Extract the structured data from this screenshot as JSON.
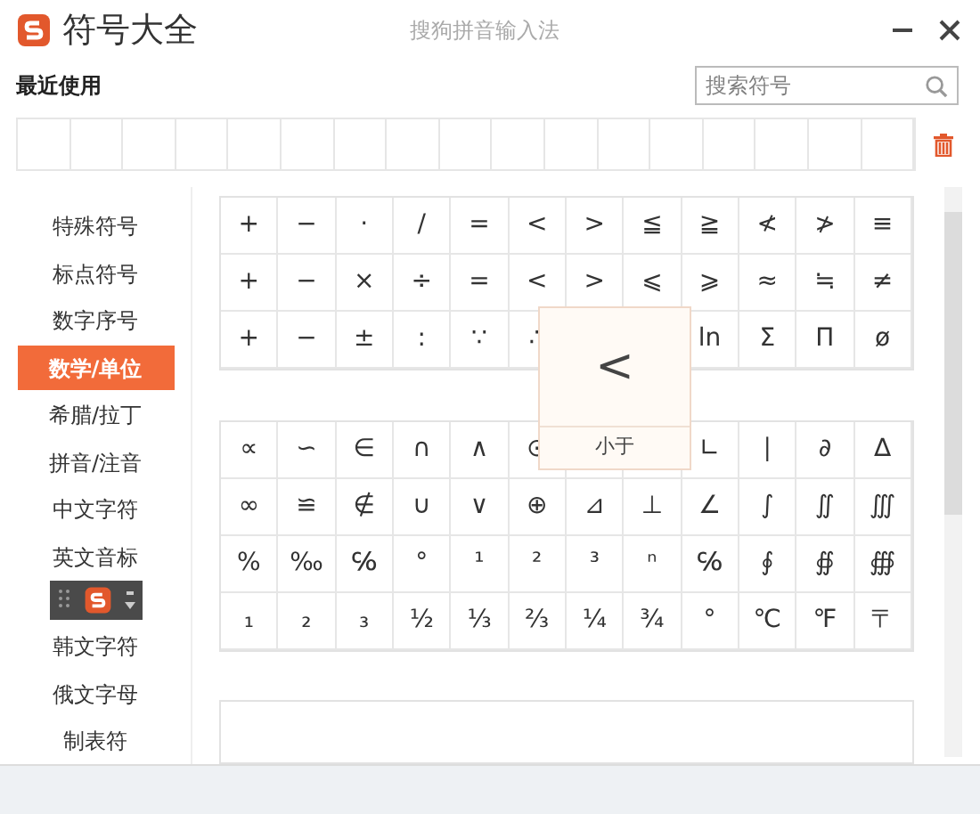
{
  "window": {
    "title": "符号大全",
    "subtitle": "搜狗拼音输入法"
  },
  "recent": {
    "label": "最近使用",
    "search": {
      "placeholder": "搜索符号"
    }
  },
  "sidebar": {
    "items": [
      {
        "label": "特殊符号",
        "selected": false
      },
      {
        "label": "标点符号",
        "selected": false
      },
      {
        "label": "数字序号",
        "selected": false
      },
      {
        "label": "数学/单位",
        "selected": true
      },
      {
        "label": "希腊/拉丁",
        "selected": false
      },
      {
        "label": "拼音/注音",
        "selected": false
      },
      {
        "label": "中文字符",
        "selected": false
      },
      {
        "label": "英文音标",
        "selected": false
      },
      {
        "label": "韩文字符",
        "selected": false
      },
      {
        "label": "俄文字母",
        "selected": false
      },
      {
        "label": "制表符",
        "selected": false
      }
    ]
  },
  "grids": [
    {
      "rows": [
        [
          "+",
          "−",
          "·",
          "/",
          "=",
          "<",
          ">",
          "≦",
          "≧",
          "≮",
          "≯",
          "≡"
        ],
        [
          "+",
          "−",
          "×",
          "÷",
          "=",
          "<",
          ">",
          "⩽",
          "⩾",
          "≈",
          "≒",
          "≠"
        ],
        [
          "+",
          "−",
          "±",
          ":",
          "∵",
          "∴",
          null,
          null,
          "ln",
          "Σ",
          "Π",
          "ø"
        ]
      ]
    },
    {
      "rows": [
        [
          "∝",
          "∽",
          "∈",
          "∩",
          "∧",
          "⊙",
          null,
          null,
          "∟",
          "∣",
          "∂",
          "∆"
        ],
        [
          "∞",
          "≌",
          "∉",
          "∪",
          "∨",
          "⊕",
          "⊿",
          "⊥",
          "∠",
          "∫",
          "∬",
          "∭"
        ],
        [
          "%",
          "‰",
          "℅",
          "°",
          "¹",
          "²",
          "³",
          "ⁿ",
          "℅",
          "∮",
          "∯",
          "∰"
        ],
        [
          "₁",
          "₂",
          "₃",
          "½",
          "⅓",
          "⅔",
          "¼",
          "¾",
          "°",
          "℃",
          "℉",
          "〒"
        ]
      ]
    }
  ],
  "tooltip": {
    "symbol": "<",
    "name": "小于"
  }
}
